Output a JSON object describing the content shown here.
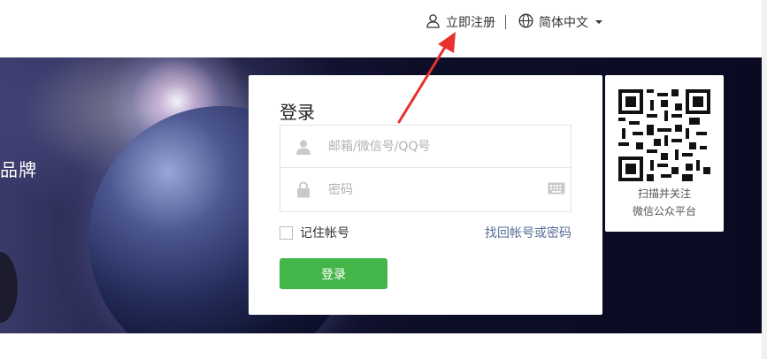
{
  "header": {
    "register_label": "立即注册",
    "language_label": "简体中文",
    "icons": {
      "register": "user-icon",
      "language": "globe-icon",
      "dropdown": "chevron-down-icon"
    }
  },
  "banner": {
    "side_text": "品牌"
  },
  "login": {
    "title": "登录",
    "account_placeholder": "邮箱/微信号/QQ号",
    "password_placeholder": "密码",
    "remember_label": "记住帐号",
    "forgot_label": "找回帐号或密码",
    "submit_label": "登录"
  },
  "qr": {
    "caption_line1": "扫描并关注",
    "caption_line2": "微信公众平台"
  },
  "colors": {
    "accent_green": "#44b549",
    "link_blue": "#576b95",
    "annotation_red": "#e8312f"
  }
}
